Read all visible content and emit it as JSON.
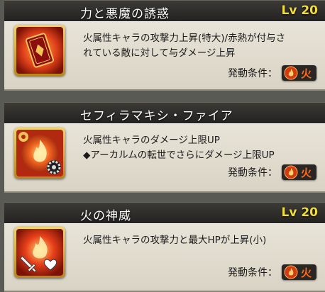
{
  "cond_label": "発動条件：",
  "skills": [
    {
      "name": "力と悪魔の誘惑",
      "level": "Lv 20",
      "desc": [
        "火属性キャラの攻撃力上昇(特大)/赤熱が付与さ",
        "れている敵に対して与ダメージ上昇"
      ],
      "element": "火",
      "icon": "red-card-icon"
    },
    {
      "name": "セフィラマキシ・ファイア",
      "level": "",
      "desc": [
        "火属性キャラのダメージ上限UP",
        "◆アーカルムの転世でさらにダメージ上限UP"
      ],
      "element": "火",
      "icon": "flame-orb-gear-icon"
    },
    {
      "name": "火の神威",
      "level": "Lv 20",
      "desc": [
        "火属性キャラの攻撃力と最大HPが上昇(小)"
      ],
      "element": "火",
      "icon": "flame-sword-heart-icon"
    }
  ],
  "colors": {
    "level": "#f2dc3a",
    "fire": "#ff6a1a"
  }
}
